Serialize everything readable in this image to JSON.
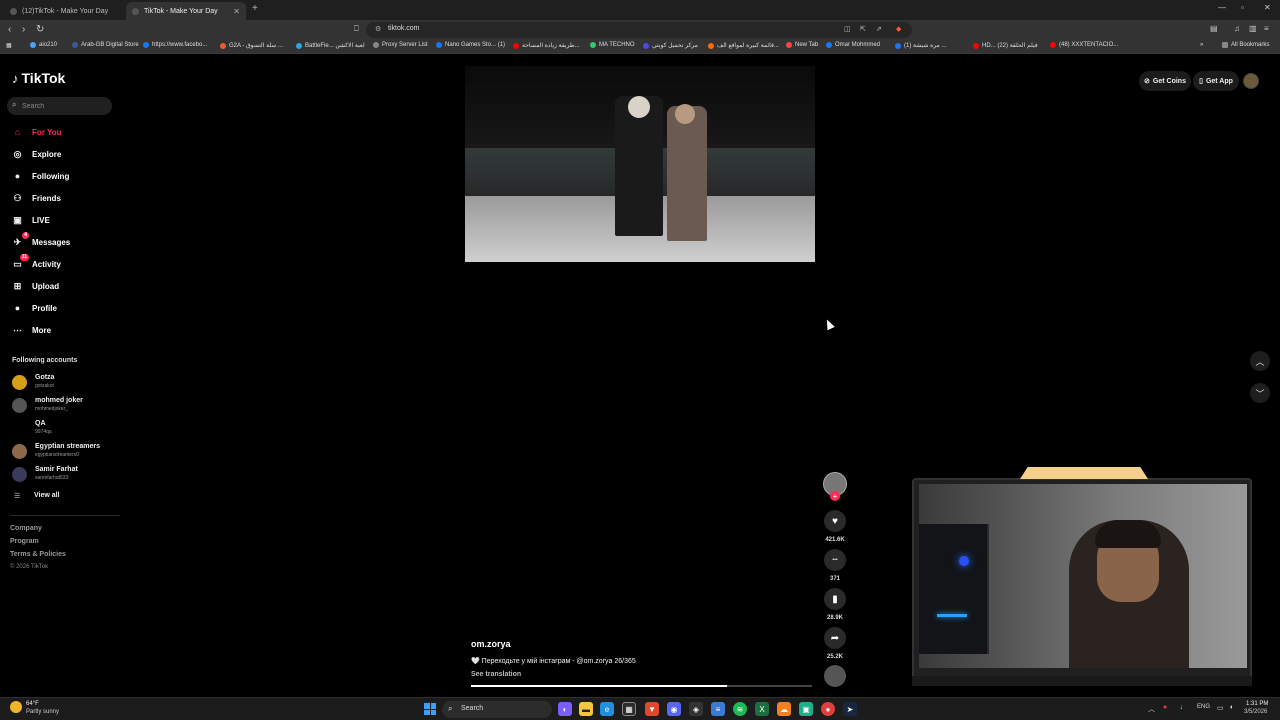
{
  "browser": {
    "tabs": [
      {
        "title": "(12)TikTok - Make Your Day",
        "active": false
      },
      {
        "title": "TikTok - Make Your Day",
        "active": true
      }
    ],
    "url": "tiktok.com",
    "bookmarks": [
      {
        "label": "aio210",
        "color": "#4aa3ff"
      },
      {
        "label": "Arab-GB Digital Store",
        "color": "#3b5998"
      },
      {
        "label": "https://www.facebo...",
        "color": "#1877f2"
      },
      {
        "label": "G2A - سلة التسوق ...",
        "color": "#f05a28"
      },
      {
        "label": "BattleFie... لعبة الاكشن",
        "color": "#27a9e1"
      },
      {
        "label": "Proxy Server List",
        "color": "#888888"
      },
      {
        "label": "Nano Games Sto... (1)",
        "color": "#1877f2"
      },
      {
        "label": "طريقة زيادة المساحة...",
        "color": "#ff0000"
      },
      {
        "label": "MA TECHNO",
        "color": "#2ecc71"
      },
      {
        "label": "مركز تحميل كوبتي",
        "color": "#4a4ae8"
      },
      {
        "label": "قائمة كبيرة لمواقع الف...",
        "color": "#ff6a00"
      },
      {
        "label": "New Tab",
        "color": "#ff4444"
      },
      {
        "label": "Omar Mohmmed",
        "color": "#1877f2"
      },
      {
        "label": "(1) مرة شيشة ...",
        "color": "#1877f2"
      },
      {
        "label": "HD... فيلم الحلقة (22)",
        "color": "#ff0000"
      },
      {
        "label": "(48) XXXTENTACIO...",
        "color": "#ff0000"
      }
    ],
    "all_bookmarks": "All Bookmarks"
  },
  "tiktok": {
    "logo": "TikTok",
    "search_placeholder": "Search",
    "nav": [
      {
        "label": "For You",
        "icon": "home-icon",
        "glyph": "⌂",
        "active": true,
        "badge": ""
      },
      {
        "label": "Explore",
        "icon": "compass-icon",
        "glyph": "◎",
        "active": false,
        "badge": ""
      },
      {
        "label": "Following",
        "icon": "following-icon",
        "glyph": "●",
        "active": false,
        "badge": ""
      },
      {
        "label": "Friends",
        "icon": "friends-icon",
        "glyph": "⚇",
        "active": false,
        "badge": ""
      },
      {
        "label": "LIVE",
        "icon": "live-icon",
        "glyph": "▣",
        "active": false,
        "badge": ""
      },
      {
        "label": "Messages",
        "icon": "messages-icon",
        "glyph": "✈",
        "active": false,
        "badge": "4"
      },
      {
        "label": "Activity",
        "icon": "activity-icon",
        "glyph": "▭",
        "active": false,
        "badge": "11"
      },
      {
        "label": "Upload",
        "icon": "upload-icon",
        "glyph": "⊞",
        "active": false,
        "badge": ""
      },
      {
        "label": "Profile",
        "icon": "profile-icon",
        "glyph": "●",
        "active": false,
        "badge": ""
      },
      {
        "label": "More",
        "icon": "more-icon",
        "glyph": "⋯",
        "active": false,
        "badge": ""
      }
    ],
    "following_title": "Following accounts",
    "accounts": [
      {
        "name": "Gotza",
        "username": "gotzakot",
        "color": "#d4a017"
      },
      {
        "name": "mohmed joker",
        "username": "mohmedjoker_",
        "color": "#555555"
      },
      {
        "name": "QA",
        "username": "9974qa",
        "color": "#000000"
      },
      {
        "name": "Egyptian streamers",
        "username": "egyptianstreamers0",
        "color": "#8b6a4a"
      },
      {
        "name": "Samir Farhat",
        "username": "samirfarhat533",
        "color": "#3a3a5a"
      }
    ],
    "view_all": "View all",
    "footer": [
      "Company",
      "Program",
      "Terms & Policies"
    ],
    "copyright": "© 2026 TikTok",
    "get_coins": "Get Coins",
    "get_app": "Get App"
  },
  "video": {
    "author": "om.zorya",
    "caption": "🤍 Переходьте у мій інстаграм - @om.zorya 26/365",
    "see_translation": "See translation",
    "progress": 0.75,
    "actions": [
      {
        "name": "like",
        "icon": "heart-icon",
        "glyph": "♥",
        "count": "421.6K"
      },
      {
        "name": "comment",
        "icon": "comment-icon",
        "glyph": "•••",
        "count": "371"
      },
      {
        "name": "save",
        "icon": "bookmark-icon",
        "glyph": "▮",
        "count": "28.9K"
      },
      {
        "name": "share",
        "icon": "share-icon",
        "glyph": "➦",
        "count": "25.2K"
      }
    ]
  },
  "taskbar": {
    "weather_temp": "64°F",
    "weather_desc": "Partly sunny",
    "search": "Search",
    "lang": "ENG",
    "time": "1:31 PM",
    "date": "3/5/2026"
  }
}
